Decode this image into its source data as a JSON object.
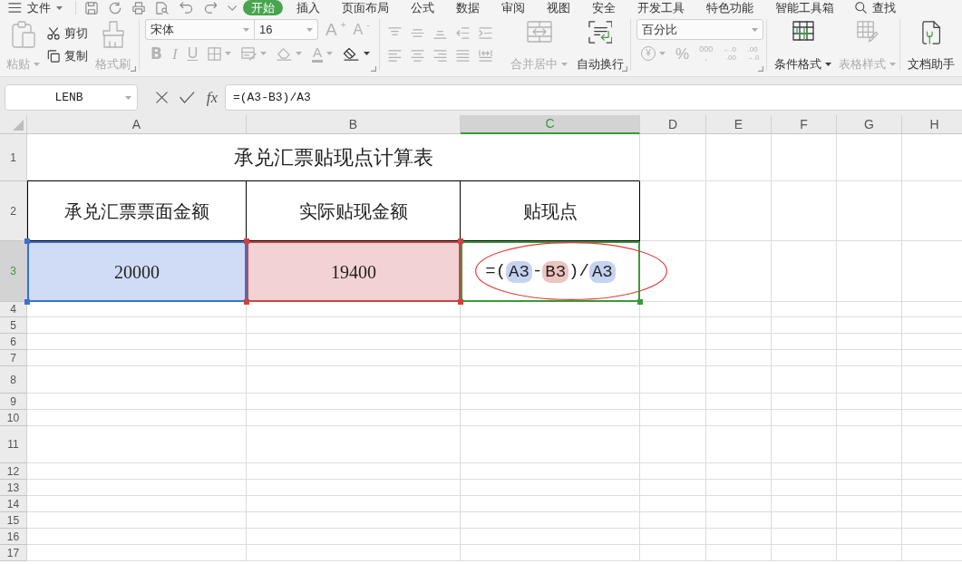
{
  "menu_bar": {
    "file_menu": "文件",
    "tabs": [
      {
        "label": "开始",
        "selected": true
      },
      {
        "label": "插入",
        "selected": false
      },
      {
        "label": "页面布局",
        "selected": false
      },
      {
        "label": "公式",
        "selected": false
      },
      {
        "label": "数据",
        "selected": false
      },
      {
        "label": "审阅",
        "selected": false
      },
      {
        "label": "视图",
        "selected": false
      },
      {
        "label": "安全",
        "selected": false
      },
      {
        "label": "开发工具",
        "selected": false
      },
      {
        "label": "特色功能",
        "selected": false
      },
      {
        "label": "智能工具箱",
        "selected": false
      }
    ],
    "search": "查找"
  },
  "ribbon": {
    "clipboard": {
      "paste": {
        "label": "粘贴",
        "dropdown": true,
        "disabled": true
      },
      "cut": {
        "label": "剪切",
        "disabled": false
      },
      "copy": {
        "label": "复制",
        "disabled": false
      },
      "format_painter": {
        "label": "格式刷",
        "dropdown": false,
        "disabled": true
      }
    },
    "font": {
      "font_name": "宋体",
      "font_size": "16",
      "size_tools": [
        {
          "kind": "grow",
          "label": "A$^{+}$",
          "disabled": true
        },
        {
          "kind": "shrink",
          "label": "A$^{-}$",
          "disabled": true
        }
      ],
      "format_tools": [
        {
          "kind": "bold",
          "label": "B",
          "dropdown": false,
          "disabled": true
        },
        {
          "kind": "italic",
          "label": "I",
          "dropdown": false,
          "disabled": true
        },
        {
          "kind": "underline",
          "label": "U",
          "dropdown": false,
          "disabled": true
        },
        {
          "kind": "border",
          "dropdown": true,
          "disabled": true
        },
        {
          "kind": "cellstyle",
          "dropdown": true,
          "disabled": true
        },
        {
          "kind": "fill",
          "dropdown": true,
          "disabled": true
        },
        {
          "kind": "fontcolor",
          "label": "A",
          "dropdown": true,
          "disabled": true
        },
        {
          "kind": "clear",
          "dropdown": true,
          "disabled": false
        }
      ]
    },
    "alignment": {
      "tools": [
        {
          "kind": "top",
          "disabled": true
        },
        {
          "kind": "middle",
          "disabled": true
        },
        {
          "kind": "bottom",
          "disabled": true
        },
        {
          "kind": "outdent",
          "disabled": true
        },
        {
          "kind": "indent",
          "disabled": true
        },
        {
          "kind": "left",
          "disabled": true
        },
        {
          "kind": "center",
          "disabled": true
        },
        {
          "kind": "right",
          "disabled": true
        },
        {
          "kind": "justify",
          "disabled": true
        },
        {
          "kind": "distribute",
          "disabled": true
        }
      ],
      "merge": {
        "label": "合并居中",
        "dropdown": true,
        "disabled": true
      },
      "wrap": {
        "label": "自动换行",
        "dropdown": false,
        "disabled": false
      }
    },
    "number": {
      "format": "百分比",
      "tools": [
        {
          "kind": "currency",
          "label": "¥",
          "dropdown": true,
          "disabled": true
        },
        {
          "kind": "percent",
          "label": "%",
          "dropdown": false,
          "disabled": true
        },
        {
          "kind": "thousands",
          "label": "000\n,",
          "dropdown": false,
          "disabled": true
        },
        {
          "kind": "add_decimal",
          "label": "←.0\n.00",
          "dropdown": false,
          "disabled": true
        },
        {
          "kind": "remove_decimal",
          "label": ".00\n→.0",
          "dropdown": false,
          "disabled": true
        }
      ]
    },
    "styles": {
      "conditional": {
        "label": "条件格式",
        "dropdown": true,
        "disabled": false
      },
      "table_style": {
        "label": "表格样式",
        "dropdown": true,
        "disabled": true
      }
    },
    "assistant": {
      "label": "文档助手",
      "dropdown": false,
      "disabled": false
    }
  },
  "formula_bar": {
    "name_box": "LENB",
    "function_label": "fx",
    "formula": "=(A3-B3)/A3"
  },
  "sheet": {
    "columns": [
      {
        "label": "A",
        "selected": false
      },
      {
        "label": "B",
        "selected": false
      },
      {
        "label": "C",
        "selected": true
      },
      {
        "label": "D",
        "selected": false
      },
      {
        "label": "E",
        "selected": false
      },
      {
        "label": "F",
        "selected": false
      },
      {
        "label": "G",
        "selected": false
      },
      {
        "label": "H",
        "selected": false
      }
    ],
    "rows": [
      {
        "label": "1",
        "selected": false,
        "cells": [
          {
            "kind": "title",
            "text": "承兑汇票贴现点计算表"
          }
        ]
      },
      {
        "label": "2",
        "selected": false,
        "cells": [
          {
            "kind": "header",
            "text": "承兑汇票票面金额"
          },
          {
            "kind": "header",
            "text": "实际贴现金额"
          },
          {
            "kind": "header",
            "text": "贴现点"
          }
        ]
      },
      {
        "label": "3",
        "selected": true,
        "cells": [
          {
            "kind": "reference",
            "text": "20000",
            "color": "#3b6fd4"
          },
          {
            "kind": "reference",
            "text": "19400",
            "color": "#c94545"
          },
          {
            "kind": "formula",
            "active": true,
            "circled": true,
            "tokens": [
              {
                "text": "=("
              },
              {
                "text": "A3",
                "color": "#c5d3f1"
              },
              {
                "text": "-"
              },
              {
                "text": "B3",
                "color": "#eec4c0"
              },
              {
                "text": ")/"
              },
              {
                "text": "A3",
                "color": "#c5d3f1"
              }
            ]
          }
        ]
      },
      {
        "label": "4",
        "selected": false
      },
      {
        "label": "5",
        "selected": false
      },
      {
        "label": "6",
        "selected": false
      },
      {
        "label": "7",
        "selected": false
      },
      {
        "label": "8",
        "selected": false
      },
      {
        "label": "9",
        "selected": false
      },
      {
        "label": "10",
        "selected": false
      },
      {
        "label": "11",
        "selected": false
      },
      {
        "label": "12",
        "selected": false
      },
      {
        "label": "13",
        "selected": false
      },
      {
        "label": "14",
        "selected": false
      },
      {
        "label": "15",
        "selected": false
      },
      {
        "label": "16",
        "selected": false
      },
      {
        "label": "17",
        "selected": false
      }
    ]
  }
}
